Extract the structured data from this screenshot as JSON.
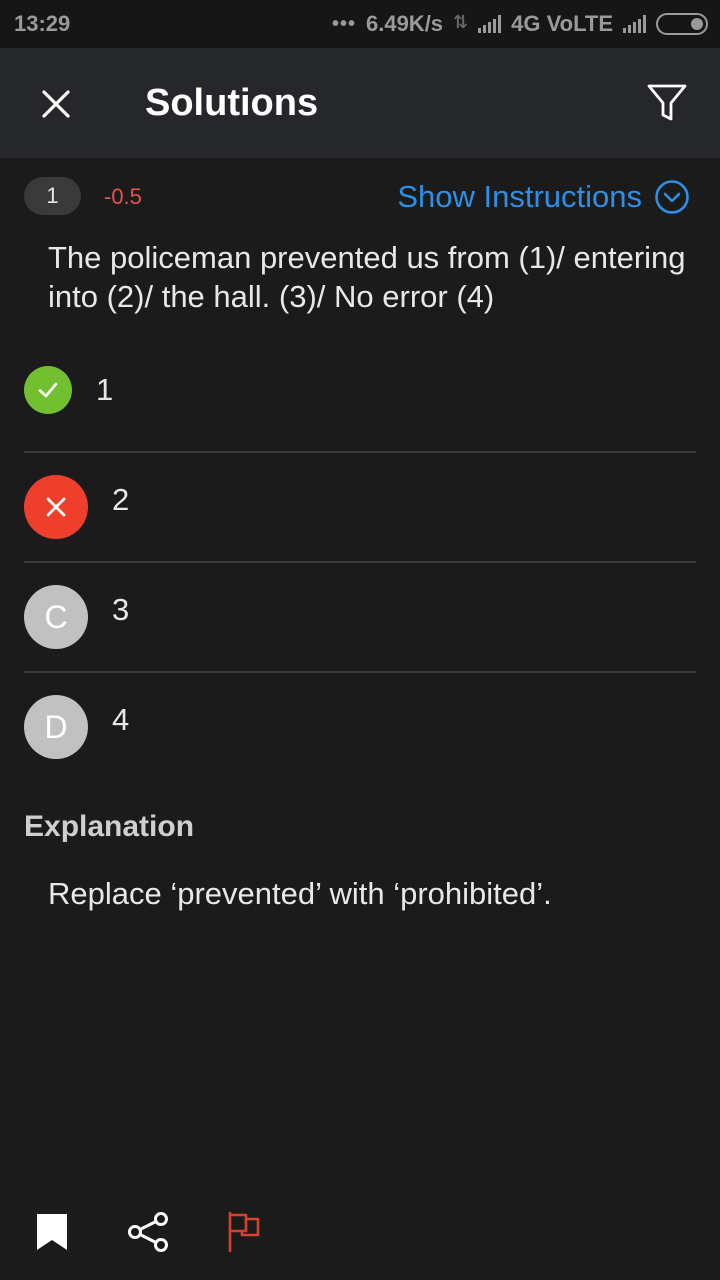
{
  "status_bar": {
    "time": "13:29",
    "dots": "•••",
    "speed": "6.49K/s",
    "network": "4G VoLTE"
  },
  "app_bar": {
    "title": "Solutions",
    "close_icon": "close-icon",
    "filter_icon": "filter-icon"
  },
  "question": {
    "number": "1",
    "score": "-0.5",
    "show_instructions": "Show Instructions",
    "text": "The policeman prevented us from (1)/ entering into (2)/ the hall. (3)/ No error (4)"
  },
  "options": [
    {
      "marker": "",
      "icon": "check-icon",
      "label": "1",
      "state": "correct",
      "color": "#72bf2f"
    },
    {
      "marker": "",
      "icon": "cross-icon",
      "label": "2",
      "state": "wrong",
      "color": "#ee3e2c"
    },
    {
      "marker": "C",
      "icon": "",
      "label": "3",
      "state": "neutral",
      "color": "#c1c1c1"
    },
    {
      "marker": "D",
      "icon": "",
      "label": "4",
      "state": "neutral",
      "color": "#c1c1c1"
    }
  ],
  "explanation": {
    "title": "Explanation",
    "text": "Replace ‘prevented’ with ‘prohibited’."
  },
  "bottom_bar": {
    "bookmark_icon": "bookmark-icon",
    "share_icon": "share-icon",
    "report_icon": "flag-icon",
    "report_color": "#d9402f"
  },
  "colors": {
    "accent": "#2d8fe6",
    "background": "#1b1b1b",
    "app_bar": "#26272b"
  }
}
